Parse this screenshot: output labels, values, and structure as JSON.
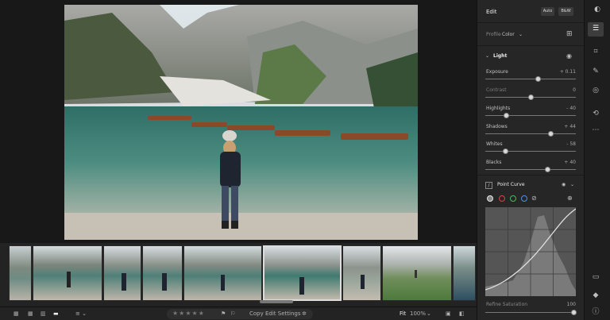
{
  "edit_panel": {
    "title": "Edit",
    "auto_label": "Auto",
    "bw_label": "B&W",
    "profile_label": "Profile",
    "profile_value": "Color",
    "light_section": "Light",
    "sliders": [
      {
        "label": "Exposure",
        "value": "+ 0.11",
        "level": 0.58
      },
      {
        "label": "Contrast",
        "value": "0",
        "level": 0.5
      },
      {
        "label": "Highlights",
        "value": "- 40",
        "level": 0.23
      },
      {
        "label": "Shadows",
        "value": "+ 44",
        "level": 0.72
      },
      {
        "label": "Whites",
        "value": "- 58",
        "level": 0.22
      },
      {
        "label": "Blacks",
        "value": "+ 40",
        "level": 0.68
      }
    ],
    "point_curve_label": "Point Curve",
    "refine_label": "Refine Saturation",
    "refine_value": "100",
    "channel_colors": [
      "#e6e6e6",
      "#e04040",
      "#3fbf5a",
      "#4d8ee6"
    ]
  },
  "bottom_bar": {
    "copy_label": "Copy Edit Settings",
    "fit_label": "Fit",
    "zoom_value": "100%",
    "stars": [
      "★",
      "★",
      "★",
      "★",
      "★"
    ]
  },
  "icons": {
    "right_icons": [
      "edit-icon",
      "crop-icon",
      "heal-icon",
      "mask-icon",
      "history-icon",
      "more-icon"
    ],
    "bottom_right_icons": [
      "comment-icon",
      "tag-icon",
      "info-icon"
    ]
  }
}
